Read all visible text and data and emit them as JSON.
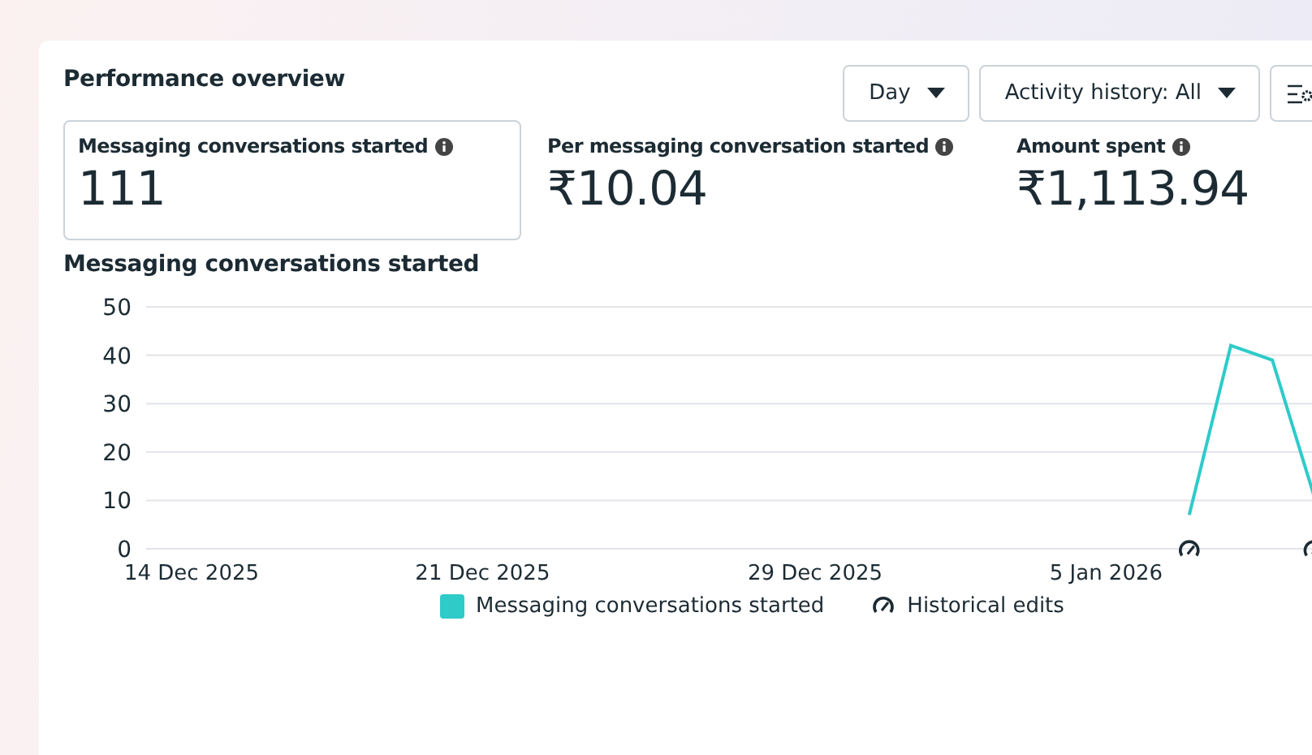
{
  "title": "Performance overview",
  "controls": [
    {
      "kind": "dropdown",
      "label": "Day"
    },
    {
      "kind": "dropdown",
      "label": "Activity history: All"
    },
    {
      "kind": "settings"
    }
  ],
  "metrics": [
    {
      "label": "Messaging conversations started",
      "value": "111",
      "selected": true
    },
    {
      "label": "Per messaging conversation started",
      "value": "₹10.04",
      "selected": false
    },
    {
      "label": "Amount spent",
      "value": "₹1,113.94",
      "selected": false
    }
  ],
  "chart_title": "Messaging conversations started",
  "chart_data": {
    "type": "line",
    "categories": [
      "14 Dec 2025",
      null,
      null,
      null,
      null,
      null,
      null,
      "21 Dec 2025",
      null,
      null,
      null,
      null,
      null,
      null,
      null,
      "29 Dec 2025",
      null,
      null,
      null,
      null,
      null,
      null,
      "5 Jan 2026",
      null,
      null,
      null,
      null,
      null
    ],
    "series": [
      {
        "name": "Messaging conversations started",
        "color": "#2ecbc9",
        "values": [
          null,
          null,
          null,
          null,
          null,
          null,
          null,
          null,
          null,
          null,
          null,
          null,
          null,
          null,
          null,
          null,
          null,
          null,
          null,
          null,
          null,
          null,
          null,
          null,
          7,
          42,
          39,
          11
        ]
      },
      {
        "name": "Historical edits",
        "type": "scatter",
        "color": "#1c2b33",
        "values": [
          null,
          null,
          null,
          null,
          null,
          null,
          null,
          null,
          null,
          null,
          null,
          null,
          null,
          null,
          null,
          null,
          null,
          null,
          null,
          null,
          null,
          null,
          null,
          null,
          0,
          null,
          null,
          0
        ]
      }
    ],
    "ylim": [
      0,
      50
    ],
    "grid": true,
    "yticks": [
      0,
      10,
      20,
      30,
      40,
      50
    ]
  }
}
